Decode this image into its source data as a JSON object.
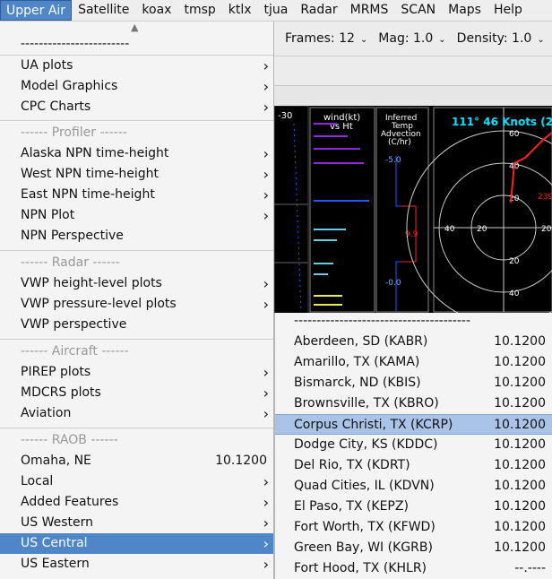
{
  "menubar": {
    "items": [
      "Upper Air",
      "Satellite",
      "koax",
      "tmsp",
      "ktlx",
      "tjua",
      "Radar",
      "MRMS",
      "SCAN",
      "Maps",
      "Help"
    ]
  },
  "toolbar": {
    "frames": "Frames: 12",
    "mag": "Mag: 1.0",
    "density": "Density: 1.0"
  },
  "display": {
    "left_value": "-30",
    "wind_title": [
      "wind(kt)",
      "vs Ht"
    ],
    "advection_title": [
      "Inferred",
      "Temp",
      "Advection",
      "(C/hr)"
    ],
    "adv_values": [
      "-5.0",
      "9.9",
      "-0.0"
    ],
    "hodo_label": "111° 46 Knots (2",
    "hodo_ticks": [
      "60",
      "40",
      "20",
      "20",
      "40",
      "20",
      "40",
      "20",
      "239"
    ],
    "colors": {
      "cyan": "#00e5ff",
      "red": "#ff2020",
      "purple": "#8a2be2",
      "blue": "#1e5aff"
    }
  },
  "menu": {
    "scroll_icon": "chevron-up-icon",
    "dash_line": "------------------------",
    "groups": {
      "top": [
        "UA plots",
        "Model Graphics",
        "CPC Charts"
      ],
      "profiler_header": "------ Profiler ------",
      "profiler": [
        "Alaska NPN time-height",
        "West NPN time-height",
        "East NPN time-height",
        "NPN Plot",
        "NPN Perspective"
      ],
      "radar_header": "------ Radar ------",
      "radar": [
        "VWP height-level plots",
        "VWP pressure-level plots",
        "VWP perspective"
      ],
      "aircraft_header": "------ Aircraft ------",
      "aircraft": [
        "PIREP plots",
        "MDCRS plots",
        "Aviation"
      ],
      "raob_header": "------ RAOB ------",
      "omaha": {
        "label": "Omaha, NE",
        "value": "10.1200"
      },
      "raob": [
        "Local",
        "Added Features",
        "US Western",
        "US Central",
        "US Eastern"
      ]
    }
  },
  "submenu": {
    "dash_line": "---------------------------------------",
    "stations": [
      {
        "label": "Aberdeen, SD (KABR)",
        "value": "10.1200"
      },
      {
        "label": "Amarillo, TX (KAMA)",
        "value": "10.1200"
      },
      {
        "label": "Bismarck, ND (KBIS)",
        "value": "10.1200"
      },
      {
        "label": "Brownsville, TX (KBRO)",
        "value": "10.1200"
      },
      {
        "label": "Corpus Christi, TX (KCRP)",
        "value": "10.1200"
      },
      {
        "label": "Dodge City, KS (KDDC)",
        "value": "10.1200"
      },
      {
        "label": "Del Rio, TX (KDRT)",
        "value": "10.1200"
      },
      {
        "label": "Quad Cities, IL (KDVN)",
        "value": "10.1200"
      },
      {
        "label": "El Paso, TX (KEPZ)",
        "value": "10.1200"
      },
      {
        "label": "Fort Worth, TX (KFWD)",
        "value": "10.1200"
      },
      {
        "label": "Green Bay, WI (KGRB)",
        "value": "10.1200"
      },
      {
        "label": "Fort Hood, TX (KHLR)",
        "value": "--.----"
      }
    ]
  }
}
